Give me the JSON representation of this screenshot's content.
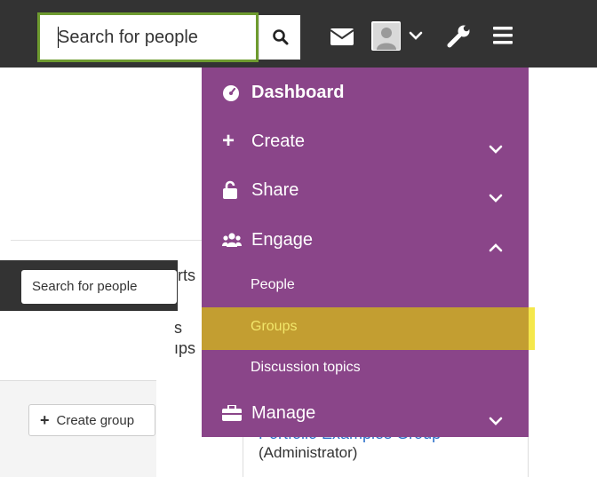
{
  "header": {
    "search_placeholder": "Search for people",
    "icons": [
      "search-icon",
      "envelope-icon",
      "user-avatar-icon",
      "chevron-down-icon",
      "wrench-icon",
      "hamburger-icon"
    ]
  },
  "menu": {
    "dashboard": "Dashboard",
    "create": "Create",
    "share": "Share",
    "engage": "Engage",
    "people": "People",
    "groups": "Groups",
    "discussion_topics": "Discussion topics",
    "manage": "Manage"
  },
  "colors": {
    "menu_bg": "#8a4589",
    "navbar": "#333333",
    "focus_border": "#6e9b2f",
    "active_item": "#c39e31",
    "active_text": "#f2e66a"
  },
  "background": {
    "search_placeholder": "Search for people",
    "frag_1": "rts",
    "frag_2": "s",
    "frag_3": "ıps",
    "create_group": "Create group",
    "group_link": "Portfolio Examples Group",
    "group_role": "(Administrator)"
  }
}
